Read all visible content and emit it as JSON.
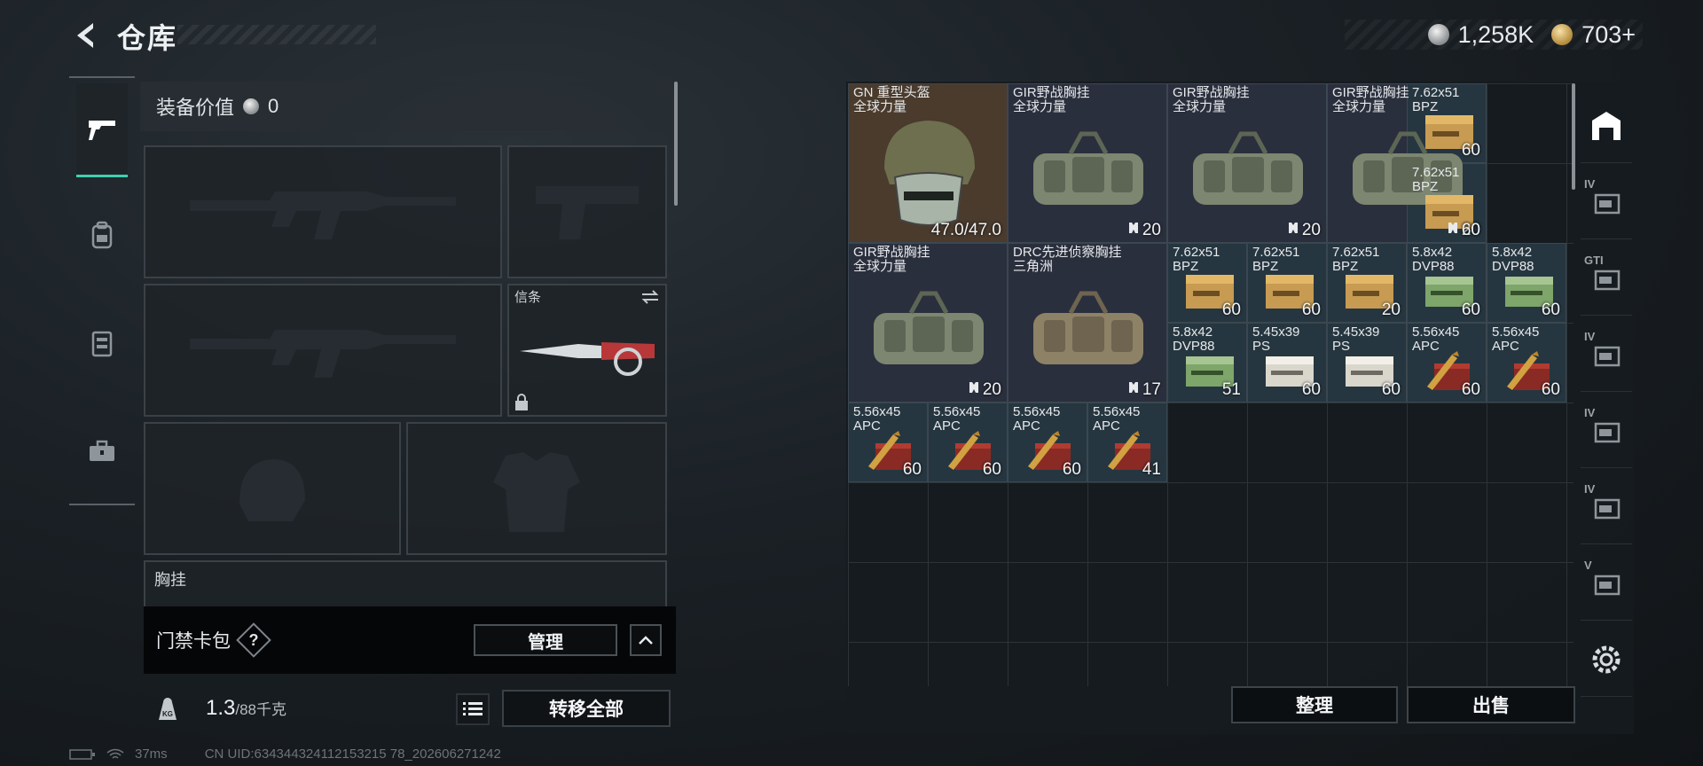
{
  "header": {
    "title": "仓库",
    "currency": [
      {
        "icon": "silver-coin-icon",
        "value": "1,258K"
      },
      {
        "icon": "gold-coin-icon",
        "value": "703+"
      }
    ]
  },
  "left_tabs": [
    {
      "icon": "pistol-icon",
      "active": true
    },
    {
      "icon": "backpack-icon",
      "active": false
    },
    {
      "icon": "chest-rig-icon",
      "active": false
    },
    {
      "icon": "toolbox-icon",
      "active": false
    }
  ],
  "equipment": {
    "value_label": "装备价值",
    "value": "0",
    "melee_slot_label": "信条",
    "chest_rig_label": "胸挂"
  },
  "keycard": {
    "label": "门禁卡包",
    "help": "?",
    "manage_label": "管理"
  },
  "weight": {
    "current": "1.3",
    "max": "/88千克",
    "transfer_label": "转移全部"
  },
  "status": {
    "ping": "37ms",
    "uid": "CN UID:634344324112153215 78_202606271242"
  },
  "inventory": {
    "items": [
      {
        "name": "GN 重型头盔",
        "sub": "全球力量",
        "count": "47.0/47.0",
        "kind": "helmet",
        "bg": "bg-brown"
      },
      {
        "name": "GIR野战胸挂",
        "sub": "全球力量",
        "count": "20",
        "kind": "rig",
        "bg": "bg-dark",
        "durability": true
      },
      {
        "name": "GIR野战胸挂",
        "sub": "全球力量",
        "count": "20",
        "kind": "rig",
        "bg": "bg-dark",
        "durability": true
      },
      {
        "name": "GIR野战胸挂",
        "sub": "全球力量",
        "count": "20",
        "kind": "rig",
        "bg": "bg-dark",
        "durability": true
      },
      {
        "name": "7.62x51",
        "sub": "BPZ",
        "count": "60",
        "kind": "ammo-box",
        "bg": "bg-slate"
      },
      {
        "name": "7.62x51",
        "sub": "BPZ",
        "count": "60",
        "kind": "ammo-box",
        "bg": "bg-slate"
      },
      {
        "name": "GIR野战胸挂",
        "sub": "全球力量",
        "count": "20",
        "kind": "rig",
        "bg": "bg-dark",
        "durability": true
      },
      {
        "name": "DRC先进侦察胸挂",
        "sub": "三角洲",
        "count": "17",
        "kind": "rig-tan",
        "bg": "bg-dark",
        "durability": true
      },
      {
        "name": "7.62x51",
        "sub": "BPZ",
        "count": "60",
        "kind": "ammo-box",
        "bg": "bg-slate"
      },
      {
        "name": "7.62x51",
        "sub": "BPZ",
        "count": "60",
        "kind": "ammo-box",
        "bg": "bg-slate"
      },
      {
        "name": "7.62x51",
        "sub": "BPZ",
        "count": "20",
        "kind": "ammo-box",
        "bg": "bg-slate"
      },
      {
        "name": "5.8x42",
        "sub": "DVP88",
        "count": "60",
        "kind": "ammo-green",
        "bg": "bg-slate"
      },
      {
        "name": "5.8x42",
        "sub": "DVP88",
        "count": "60",
        "kind": "ammo-green",
        "bg": "bg-slate"
      },
      {
        "name": "5.8x42",
        "sub": "DVP88",
        "count": "51",
        "kind": "ammo-green",
        "bg": "bg-slate"
      },
      {
        "name": "5.45x39",
        "sub": "PS",
        "count": "60",
        "kind": "ammo-white",
        "bg": "bg-slate"
      },
      {
        "name": "5.45x39",
        "sub": "PS",
        "count": "60",
        "kind": "ammo-white",
        "bg": "bg-slate"
      },
      {
        "name": "5.56x45",
        "sub": "APC",
        "count": "60",
        "kind": "ammo-red",
        "bg": "bg-slate"
      },
      {
        "name": "5.56x45",
        "sub": "APC",
        "count": "60",
        "kind": "ammo-red",
        "bg": "bg-slate"
      },
      {
        "name": "5.56x45",
        "sub": "APC",
        "count": "60",
        "kind": "ammo-red",
        "bg": "bg-slate"
      },
      {
        "name": "5.56x45",
        "sub": "APC",
        "count": "60",
        "kind": "ammo-red",
        "bg": "bg-slate"
      },
      {
        "name": "5.56x45",
        "sub": "APC",
        "count": "60",
        "kind": "ammo-red",
        "bg": "bg-slate"
      },
      {
        "name": "5.56x45",
        "sub": "APC",
        "count": "41",
        "kind": "ammo-red",
        "bg": "bg-slate"
      }
    ],
    "sort_label": "整理",
    "sell_label": "出售"
  },
  "right_tabs": [
    {
      "icon": "warehouse-icon",
      "num": ""
    },
    {
      "icon": "storage-iv-icon",
      "num": "IV"
    },
    {
      "icon": "storage-gti-icon",
      "num": "GTI"
    },
    {
      "icon": "storage-iv-2-icon",
      "num": "IV"
    },
    {
      "icon": "storage-iv-add-icon",
      "num": "IV"
    },
    {
      "icon": "storage-iv-3-icon",
      "num": "IV"
    },
    {
      "icon": "storage-v-icon",
      "num": "V"
    },
    {
      "icon": "settings-gear-icon",
      "num": ""
    }
  ]
}
